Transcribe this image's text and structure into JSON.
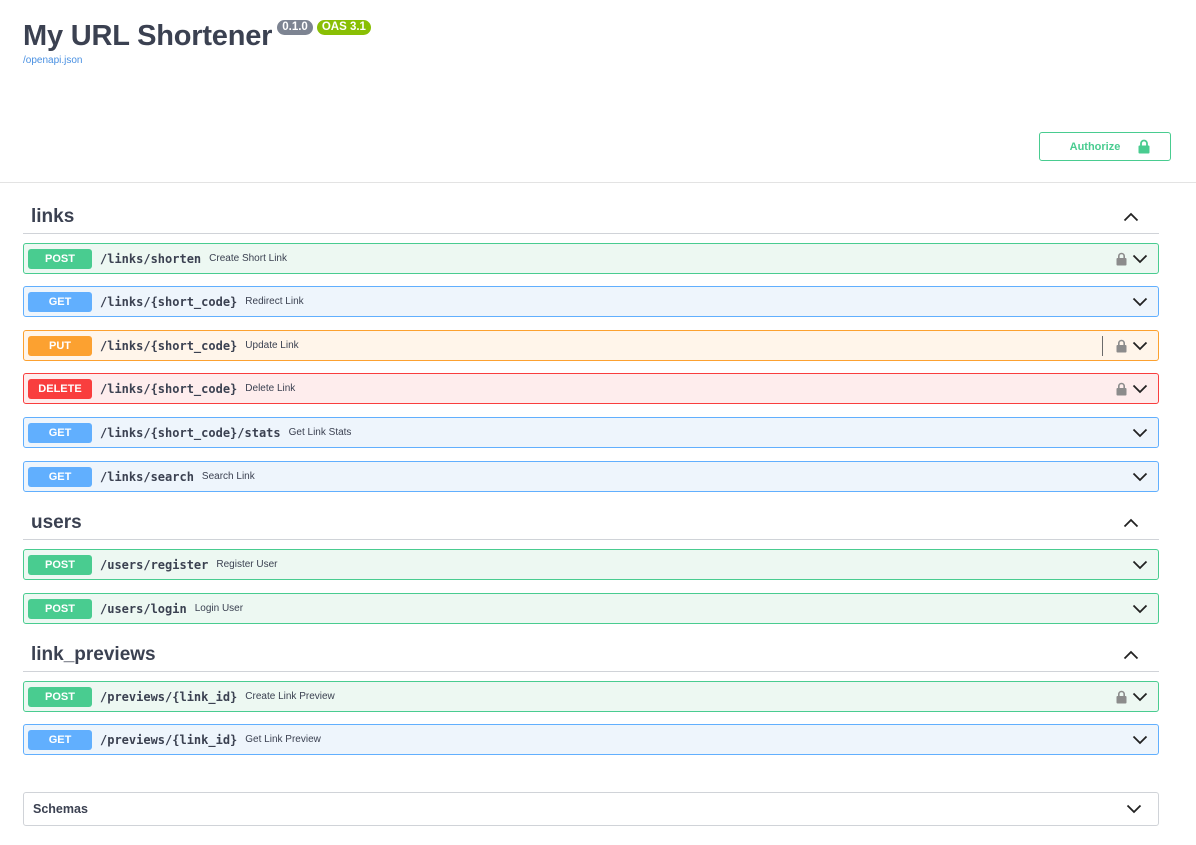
{
  "info": {
    "title": "My URL Shortener",
    "version_badge": "0.1.0",
    "oas_badge": "OAS 3.1",
    "spec_link": "/openapi.json"
  },
  "authorize": {
    "label": "Authorize",
    "icon": "lock-icon"
  },
  "tags": [
    {
      "name": "links",
      "icon": "chevron-up-icon",
      "operations": [
        {
          "method": "POST",
          "path": "/links/shorten",
          "summary": "Create Short Link",
          "locked": true,
          "separator": false
        },
        {
          "method": "GET",
          "path": "/links/{short_code}",
          "summary": "Redirect Link",
          "locked": false,
          "separator": false
        },
        {
          "method": "PUT",
          "path": "/links/{short_code}",
          "summary": "Update Link",
          "locked": true,
          "separator": true
        },
        {
          "method": "DELETE",
          "path": "/links/{short_code}",
          "summary": "Delete Link",
          "locked": true,
          "separator": false
        },
        {
          "method": "GET",
          "path": "/links/{short_code}/stats",
          "summary": "Get Link Stats",
          "locked": false,
          "separator": false
        },
        {
          "method": "GET",
          "path": "/links/search",
          "summary": "Search Link",
          "locked": false,
          "separator": false
        }
      ]
    },
    {
      "name": "users",
      "icon": "chevron-up-icon",
      "operations": [
        {
          "method": "POST",
          "path": "/users/register",
          "summary": "Register User",
          "locked": false,
          "separator": false
        },
        {
          "method": "POST",
          "path": "/users/login",
          "summary": "Login User",
          "locked": false,
          "separator": false
        }
      ]
    },
    {
      "name": "link_previews",
      "icon": "chevron-up-icon",
      "operations": [
        {
          "method": "POST",
          "path": "/previews/{link_id}",
          "summary": "Create Link Preview",
          "locked": true,
          "separator": false
        },
        {
          "method": "GET",
          "path": "/previews/{link_id}",
          "summary": "Get Link Preview",
          "locked": false,
          "separator": false
        }
      ]
    }
  ],
  "schemas": {
    "label": "Schemas",
    "icon": "chevron-down-icon"
  },
  "colors": {
    "post": "#49cc90",
    "get": "#61affe",
    "put": "#fca130",
    "delete": "#f93e3e"
  }
}
